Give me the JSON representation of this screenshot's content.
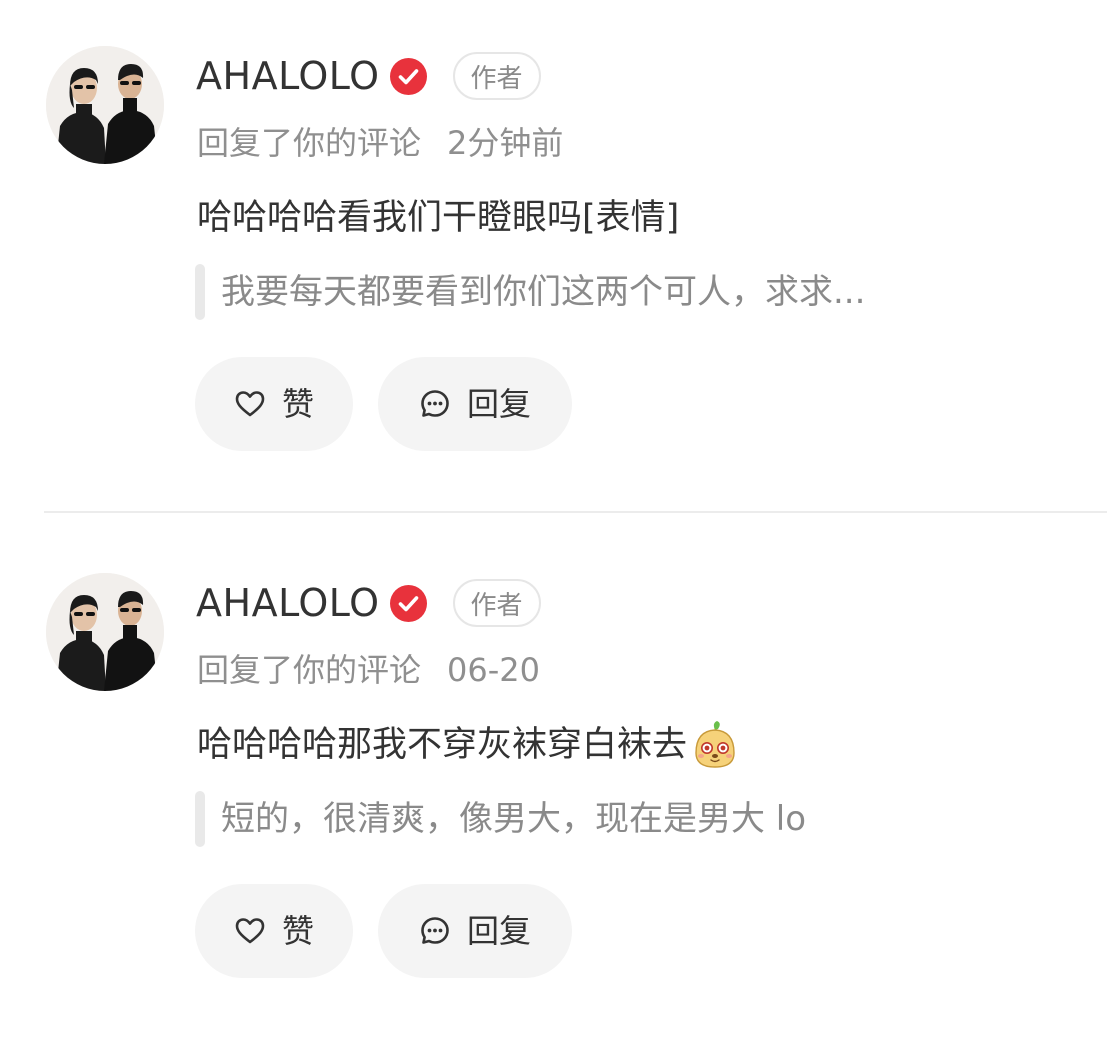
{
  "colors": {
    "verified_badge": "#e8323c",
    "text_primary": "#333333",
    "text_secondary": "#8f8f8f",
    "button_bg": "#f4f4f4",
    "quote_bar": "#e9e9e9",
    "divider": "#ececec"
  },
  "notifications": [
    {
      "username": "AHALOLO",
      "verified_icon": "verified-check-icon",
      "author_tag": "作者",
      "action": "回复了你的评论",
      "time": "2分钟前",
      "reply_text": "哈哈哈哈看我们干瞪眼吗[表情]",
      "quoted_comment": "我要每天都要看到你们这两个可人，求求...",
      "like_label": "赞",
      "reply_label": "回复"
    },
    {
      "username": "AHALOLO",
      "verified_icon": "verified-check-icon",
      "author_tag": "作者",
      "action": "回复了你的评论",
      "time": "06-20",
      "reply_text": "哈哈哈哈那我不穿灰袜穿白袜去",
      "reply_sticker": "cute-face-sticker-icon",
      "quoted_comment": "短的，很清爽，像男大，现在是男大 lo",
      "like_label": "赞",
      "reply_label": "回复"
    }
  ]
}
